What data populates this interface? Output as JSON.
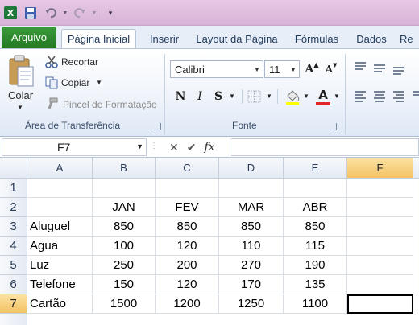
{
  "tabs": {
    "file": "Arquivo",
    "items": [
      "Página Inicial",
      "Inserir",
      "Layout da Página",
      "Fórmulas",
      "Dados",
      "Re"
    ]
  },
  "clipboard": {
    "paste": "Colar",
    "cut": "Recortar",
    "copy": "Copiar",
    "format_painter": "Pincel de Formatação",
    "label": "Área de Transferência"
  },
  "font": {
    "name": "Calibri",
    "size": "11",
    "bold": "N",
    "italic": "I",
    "underline": "S",
    "color_letter": "A",
    "grow": "A",
    "shrink": "A",
    "label": "Fonte"
  },
  "formula_bar": {
    "name_box": "F7",
    "fx": "fx",
    "value": ""
  },
  "sheet": {
    "columns": [
      "A",
      "B",
      "C",
      "D",
      "E",
      "F"
    ],
    "rows": [
      "1",
      "2",
      "3",
      "4",
      "5",
      "6",
      "7"
    ],
    "cells": [
      [
        "",
        "",
        "",
        "",
        "",
        ""
      ],
      [
        "",
        "JAN",
        "FEV",
        "MAR",
        "ABR",
        ""
      ],
      [
        "Aluguel",
        "850",
        "850",
        "850",
        "850",
        ""
      ],
      [
        "Agua",
        "100",
        "120",
        "110",
        "115",
        ""
      ],
      [
        "Luz",
        "250",
        "200",
        "270",
        "190",
        ""
      ],
      [
        "Telefone",
        "150",
        "120",
        "170",
        "135",
        ""
      ],
      [
        "Cartão",
        "1500",
        "1200",
        "1250",
        "1100",
        ""
      ]
    ],
    "active_cell": "F7"
  },
  "colors": {
    "file_tab": "#237a23",
    "selection_header": "#f4c262",
    "titlebar": "#d8b4d8"
  }
}
